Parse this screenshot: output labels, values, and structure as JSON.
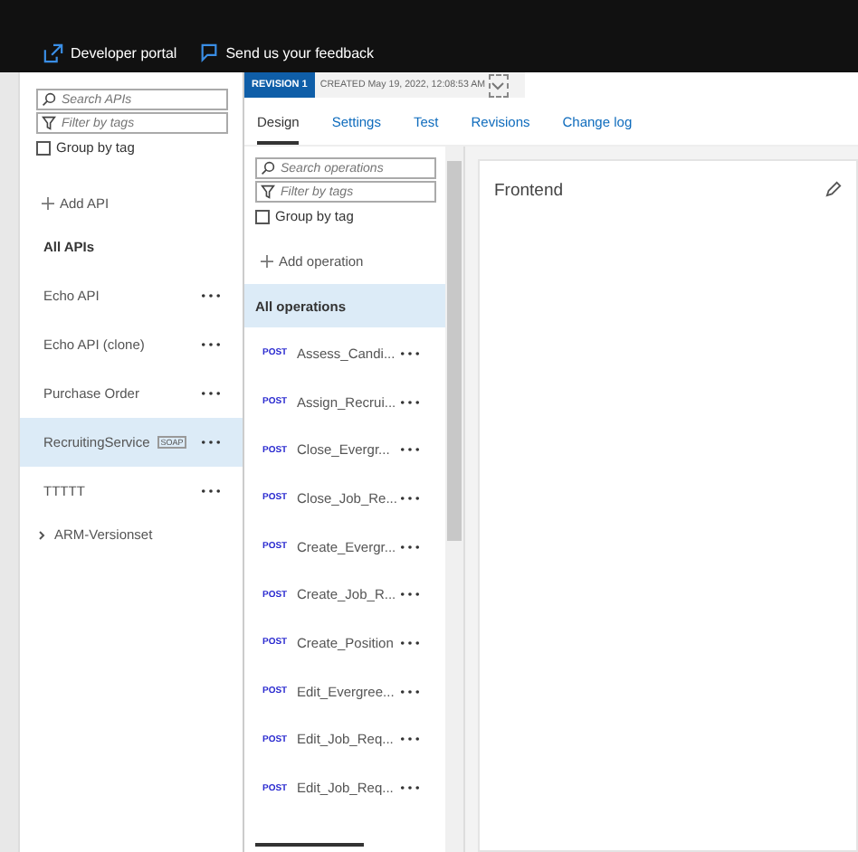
{
  "header": {
    "links": [
      {
        "label": "Developer portal"
      },
      {
        "label": "Send us your feedback"
      }
    ]
  },
  "api_panel": {
    "search": {
      "placeholder": "Search APIs"
    },
    "filter": {
      "placeholder": "Filter by tags"
    },
    "group_by_tag": {
      "label": "Group by tag",
      "checked": false
    },
    "add_label": "Add API",
    "heading": "All APIs",
    "items": [
      {
        "name": "Echo API",
        "selected": false
      },
      {
        "name": "Echo API (clone)",
        "selected": false
      },
      {
        "name": "Purchase Order",
        "selected": false
      },
      {
        "name": "RecruitingService",
        "badge": "SOAP",
        "selected": true
      },
      {
        "name": "TTTTT",
        "selected": false
      }
    ],
    "version_sets": [
      {
        "name": "ARM-Versionset",
        "expanded": false
      }
    ]
  },
  "revision_bar": {
    "badge": "REVISION 1",
    "created": "CREATED May 19, 2022, 12:08:53 AM"
  },
  "tabs": [
    {
      "label": "Design",
      "selected": true
    },
    {
      "label": "Settings",
      "selected": false
    },
    {
      "label": "Test",
      "selected": false
    },
    {
      "label": "Revisions",
      "selected": false
    },
    {
      "label": "Change log",
      "selected": false
    }
  ],
  "operations_panel": {
    "search": {
      "placeholder": "Search operations"
    },
    "filter": {
      "placeholder": "Filter by tags"
    },
    "group_by_tag": {
      "label": "Group by tag",
      "checked": false
    },
    "add_label": "Add operation",
    "all": {
      "label": "All operations",
      "selected": true
    },
    "items": [
      {
        "method": "POST",
        "name": "Assess_Candi...",
        "selected": false
      },
      {
        "method": "POST",
        "name": "Assign_Recrui...",
        "selected": false
      },
      {
        "method": "POST",
        "name": "Close_Evergr...",
        "selected": false
      },
      {
        "method": "POST",
        "name": "Close_Job_Re...",
        "selected": false
      },
      {
        "method": "POST",
        "name": "Create_Evergr...",
        "selected": false
      },
      {
        "method": "POST",
        "name": "Create_Job_R...",
        "selected": false
      },
      {
        "method": "POST",
        "name": "Create_Position",
        "selected": false
      },
      {
        "method": "POST",
        "name": "Edit_Evergree...",
        "selected": false
      },
      {
        "method": "POST",
        "name": "Edit_Job_Req...",
        "selected": false
      },
      {
        "method": "POST",
        "name": "Edit_Job_Req...",
        "selected": false
      }
    ]
  },
  "frontend": {
    "title": "Frontend"
  }
}
